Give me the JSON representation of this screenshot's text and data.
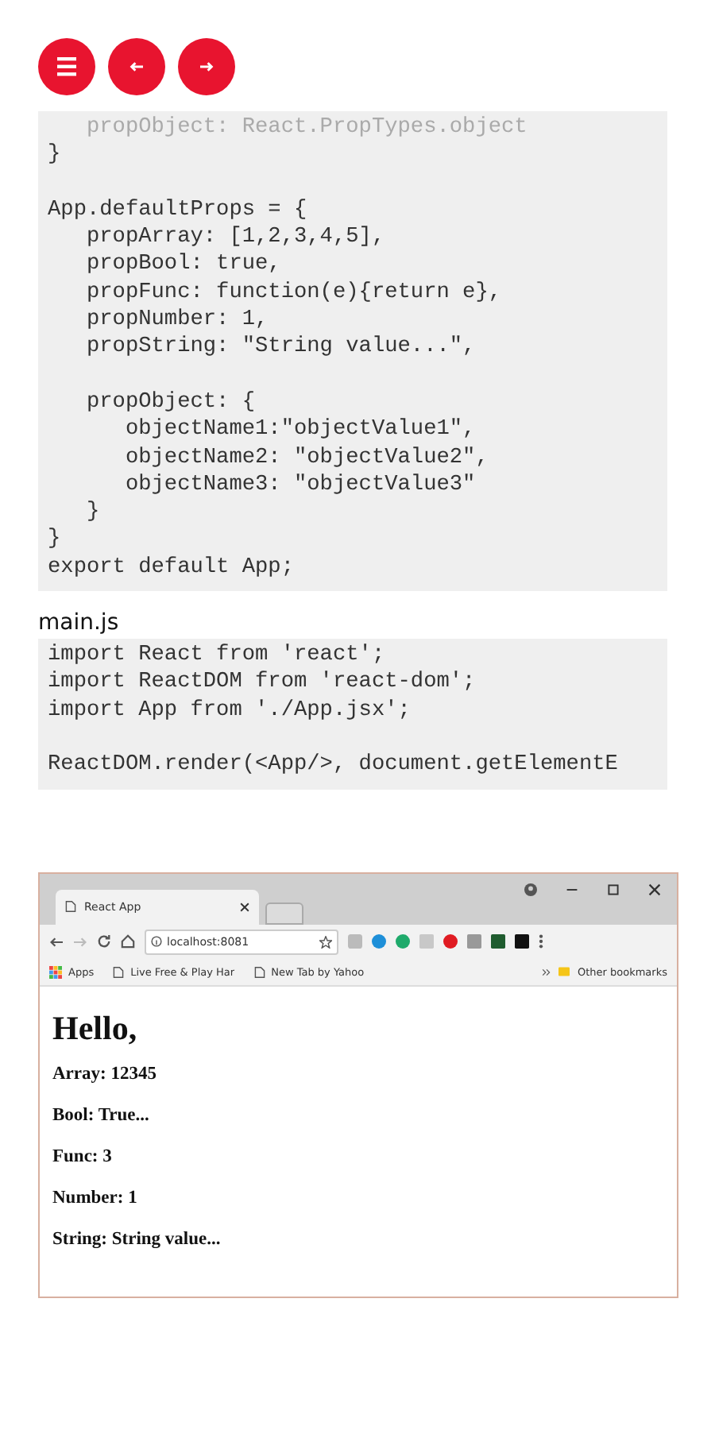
{
  "code_blocks": [
    {
      "paragraphs": [
        [
          "   propObject: React.PropTypes.object",
          "}"
        ],
        [
          "App.defaultProps = {",
          "   propArray: [1,2,3,4,5],",
          "   propBool: true,",
          "   propFunc: function(e){return e},",
          "   propNumber: 1,",
          "   propString: \"String value...\","
        ],
        [
          "   propObject: {",
          "      objectName1:\"objectValue1\",",
          "      objectName2: \"objectValue2\",",
          "      objectName3: \"objectValue3\"",
          "   }",
          "}",
          "export default App;"
        ]
      ]
    },
    {
      "filename": "main.js",
      "paragraphs": [
        [
          "import React from 'react';",
          "import ReactDOM from 'react-dom';",
          "import App from './App.jsx';"
        ],
        [
          "ReactDOM.render(<App/>, document.getElementE"
        ]
      ]
    }
  ],
  "browser": {
    "tab_title": "React App",
    "url": "localhost:8081",
    "bookmarks": [
      {
        "kind": "apps",
        "label": "Apps"
      },
      {
        "kind": "page",
        "label": "Live Free & Play Har"
      },
      {
        "kind": "page",
        "label": "New Tab by Yahoo"
      }
    ],
    "other_bookmarks": "Other bookmarks",
    "page": {
      "heading": "Hello,",
      "lines": [
        "Array: 12345",
        "Bool: True...",
        "Func: 3",
        "Number: 1",
        "String: String value..."
      ]
    }
  }
}
